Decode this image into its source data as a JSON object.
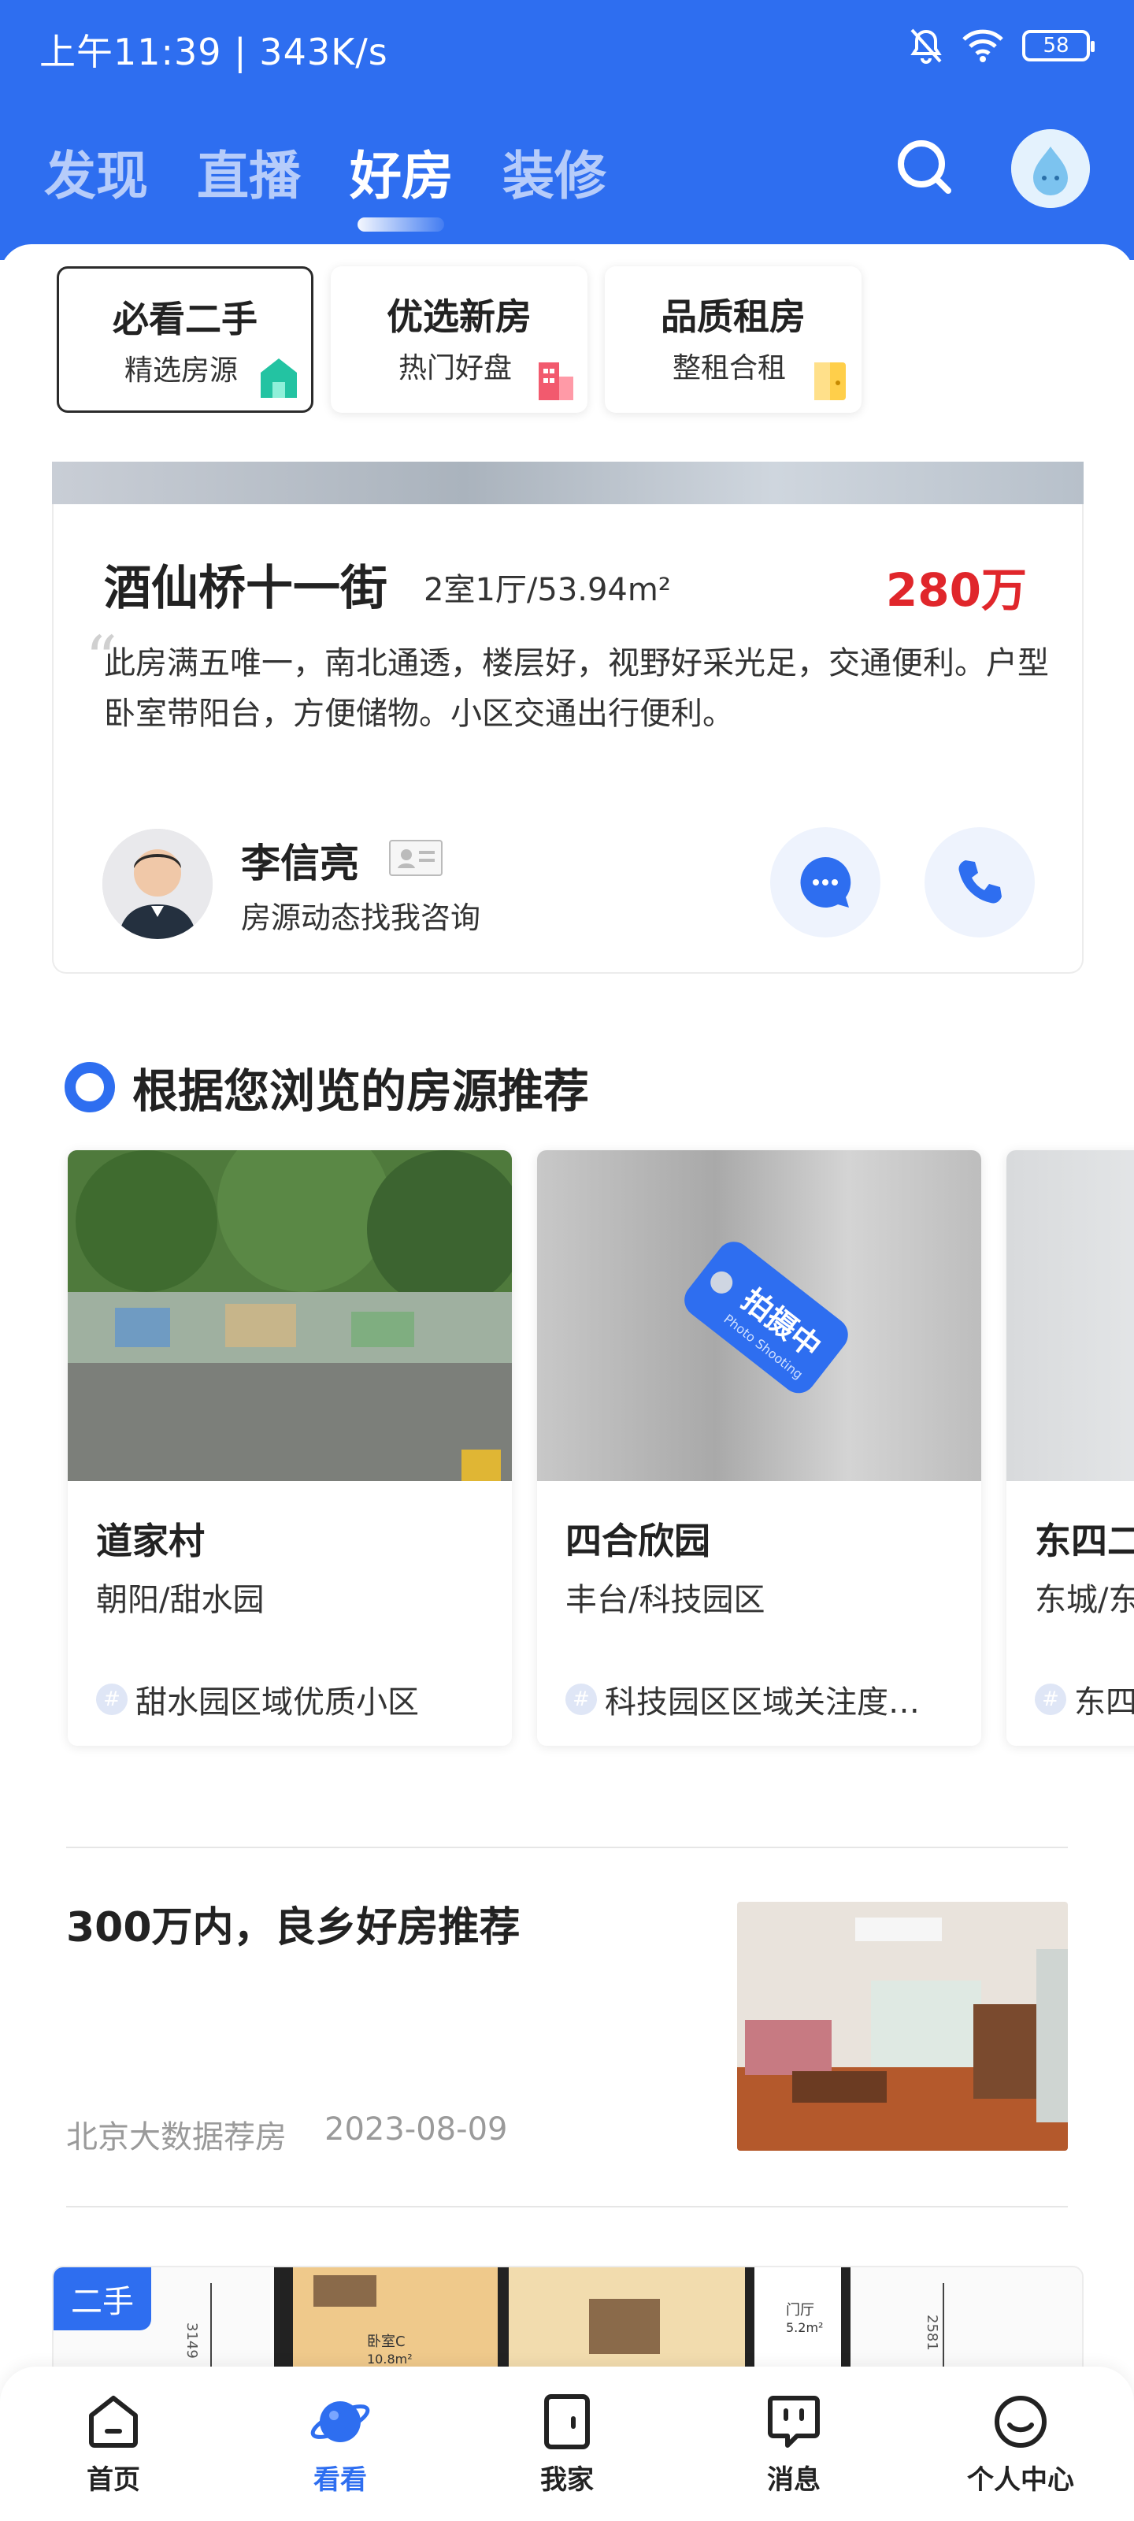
{
  "status_bar": {
    "time": "上午11:39 | 343K/s",
    "battery": "58"
  },
  "top_tabs": [
    {
      "label": "发现"
    },
    {
      "label": "直播"
    },
    {
      "label": "好房",
      "active": true
    },
    {
      "label": "装修"
    }
  ],
  "quick_entries": [
    {
      "title": "必看二手",
      "subtitle": "精选房源",
      "icon": "green-house-icon",
      "active": true
    },
    {
      "title": "优选新房",
      "subtitle": "热门好盘",
      "icon": "red-building-icon"
    },
    {
      "title": "品质租房",
      "subtitle": "整租合租",
      "icon": "yellow-door-icon"
    }
  ],
  "listing": {
    "name": "酒仙桥十一街",
    "layout": "2室1厅/53.94m²",
    "price": "280万",
    "description": "此房满五唯一，南北通透，楼层好，视野好采光足，交通便利。户型卧室带阳台，方便储物。小区交通出行便利。",
    "agent_name": "李信亮",
    "agent_subtitle": "房源动态找我咨询"
  },
  "recommend": {
    "title": "根据您浏览的房源推荐",
    "items": [
      {
        "name": "道家村",
        "area": "朝阳/甜水园",
        "tag": "甜水园区域优质小区"
      },
      {
        "name": "四合欣园",
        "area": "丰台/科技园区",
        "tag": "科技园区区域关注度…",
        "photo_status": "拍摄中",
        "photo_status_en": "Photo Shooting"
      },
      {
        "name": "东四二",
        "area": "东城/东",
        "tag": "东四"
      }
    ]
  },
  "article": {
    "title": "300万内，良乡好房推荐",
    "source": "北京大数据荐房",
    "date": "2023-08-09"
  },
  "floorplan": {
    "badge": "二手",
    "labels": {
      "room": "卧室C",
      "room_area": "10.8m²",
      "hall": "门厅",
      "hall_area": "5.2m²",
      "dim_left": "3149",
      "dim_right": "2581"
    }
  },
  "bottom_nav": [
    {
      "label": "首页",
      "icon": "home-icon"
    },
    {
      "label": "看看",
      "icon": "planet-icon",
      "active": true
    },
    {
      "label": "我家",
      "icon": "door-icon"
    },
    {
      "label": "消息",
      "icon": "message-icon"
    },
    {
      "label": "个人中心",
      "icon": "smile-icon"
    }
  ],
  "colors": {
    "brand": "#2e6ef0",
    "price": "#e0262b"
  }
}
